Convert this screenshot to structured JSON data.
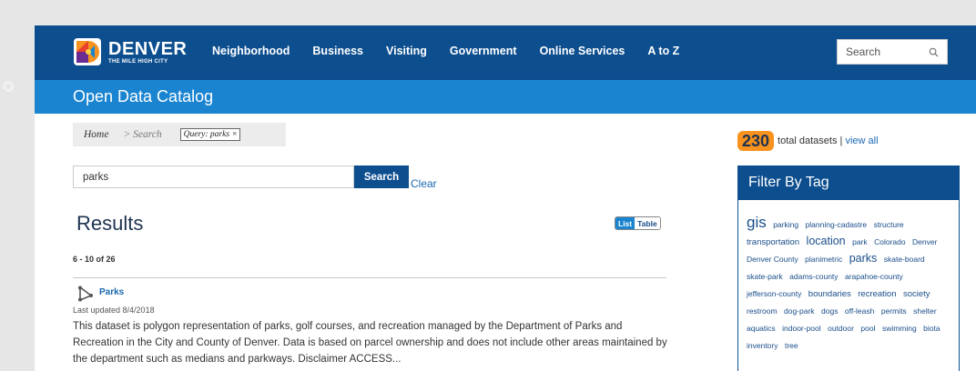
{
  "header": {
    "logo": {
      "name": "DENVER",
      "tagline": "THE MILE HIGH CITY"
    },
    "nav": [
      "Neighborhood",
      "Business",
      "Visiting",
      "Government",
      "Online Services",
      "A to Z"
    ],
    "search_placeholder": "Search"
  },
  "catalog": {
    "title": "Open Data Catalog"
  },
  "breadcrumb": {
    "home": "Home",
    "current": "> Search",
    "query": "Query: parks",
    "query_remove": "×"
  },
  "search": {
    "value": "parks",
    "button": "Search",
    "clear": "Clear"
  },
  "results": {
    "title": "Results",
    "view_list": "List",
    "view_table": "Table",
    "count": "6 - 10 of 26",
    "items": [
      {
        "title": "Parks",
        "updated": "Last updated 8/4/2018",
        "description": "This dataset is polygon representation of parks, golf courses, and recreation managed by the Department of Parks and Recreation in the City and County of Denver. Data is based on parcel ownership and does not include other areas maintained by the department such as medians and parkways. Disclaimer ACCESS..."
      }
    ]
  },
  "sidebar": {
    "total": "230",
    "total_text": "total datasets |",
    "view_all": "view all",
    "filter_title": "Filter By Tag",
    "tags": [
      {
        "label": "gis",
        "size": 4
      },
      {
        "label": "parking",
        "size": 1
      },
      {
        "label": "planning-cadastre",
        "size": 1
      },
      {
        "label": "structure",
        "size": 1
      },
      {
        "label": "transportation",
        "size": 2
      },
      {
        "label": "location",
        "size": 3
      },
      {
        "label": "park",
        "size": 1
      },
      {
        "label": "Colorado",
        "size": 1
      },
      {
        "label": "Denver",
        "size": 1
      },
      {
        "label": "Denver County",
        "size": 1
      },
      {
        "label": "planimetric",
        "size": 1
      },
      {
        "label": "parks",
        "size": 3
      },
      {
        "label": "skate-board",
        "size": 1
      },
      {
        "label": "skate-park",
        "size": 1
      },
      {
        "label": "adams-county",
        "size": 1
      },
      {
        "label": "arapahoe-county",
        "size": 1
      },
      {
        "label": "jefferson-county",
        "size": 1
      },
      {
        "label": "boundaries",
        "size": 2
      },
      {
        "label": "recreation",
        "size": 2
      },
      {
        "label": "society",
        "size": 2
      },
      {
        "label": "restroom",
        "size": 1
      },
      {
        "label": "dog-park",
        "size": 1
      },
      {
        "label": "dogs",
        "size": 1
      },
      {
        "label": "off-leash",
        "size": 1
      },
      {
        "label": "permits",
        "size": 1
      },
      {
        "label": "shelter",
        "size": 1
      },
      {
        "label": "aquatics",
        "size": 1
      },
      {
        "label": "indoor-pool",
        "size": 1
      },
      {
        "label": "outdoor",
        "size": 1
      },
      {
        "label": "pool",
        "size": 1
      },
      {
        "label": "swimming",
        "size": 1
      },
      {
        "label": "biota",
        "size": 1
      },
      {
        "label": "inventory",
        "size": 1
      },
      {
        "label": "tree",
        "size": 1
      }
    ]
  },
  "colors": {
    "nav_blue": "#0d4e8f",
    "catalog_blue": "#1b84d1",
    "link_blue": "#1a68b1",
    "badge_orange": "#f7931e"
  }
}
